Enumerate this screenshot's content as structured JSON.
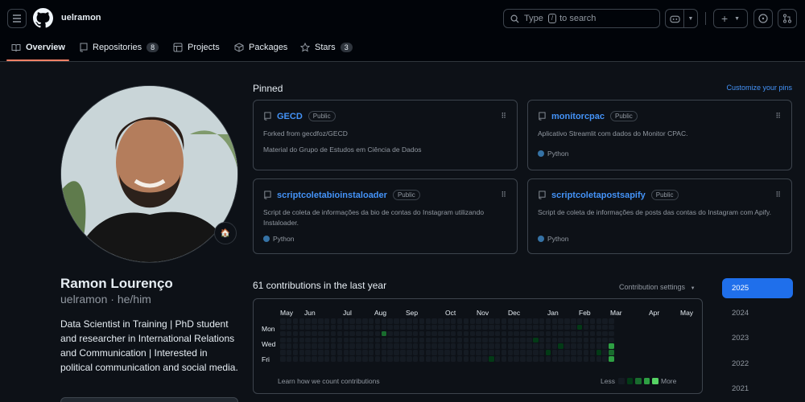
{
  "header": {
    "username": "uelramon",
    "search_placeholder": "Type",
    "search_key": "/",
    "search_suffix": "to search"
  },
  "tabs": [
    {
      "label": "Overview",
      "icon": "book-icon"
    },
    {
      "label": "Repositories",
      "count": "8",
      "icon": "repo-icon"
    },
    {
      "label": "Projects",
      "icon": "table-icon"
    },
    {
      "label": "Packages",
      "icon": "package-icon"
    },
    {
      "label": "Stars",
      "count": "3",
      "icon": "star-icon"
    }
  ],
  "profile": {
    "name": "Ramon Lourenço",
    "login": "uelramon",
    "pronouns": "he/him",
    "status_emoji": "🏠",
    "bio": "Data Scientist in Training | PhD student and researcher in International Relations and Communication | Interested in political communication and social media."
  },
  "pinned": {
    "title": "Pinned",
    "customize": "Customize your pins",
    "repos": [
      {
        "name": "GECD",
        "visibility": "Public",
        "forked_from": "Forked from gecdfoz/GECD",
        "description": "Material do Grupo de Estudos em Ciência de Dados",
        "language": ""
      },
      {
        "name": "monitorcpac",
        "visibility": "Public",
        "forked_from": "",
        "description": "Aplicativo Streamlit com dados do Monitor CPAC.",
        "language": "Python"
      },
      {
        "name": "scriptcoletabioinstaloader",
        "visibility": "Public",
        "forked_from": "",
        "description": "Script de coleta de informações da bio de contas do Instagram utilizando Instaloader.",
        "language": "Python"
      },
      {
        "name": "scriptcoletapostsapify",
        "visibility": "Public",
        "forked_from": "",
        "description": "Script de coleta de informações de posts das contas do Instagram com Apify.",
        "language": "Python"
      }
    ]
  },
  "contributions": {
    "title": "61 contributions in the last year",
    "settings": "Contribution settings",
    "months": [
      "May",
      "Jun",
      "Jul",
      "Aug",
      "Sep",
      "Oct",
      "Nov",
      "Dec",
      "Jan",
      "Feb",
      "Mar",
      "Apr",
      "May"
    ],
    "days": [
      "Mon",
      "Wed",
      "Fri"
    ],
    "learn": "Learn how we count contributions",
    "less": "Less",
    "more": "More",
    "active_cells": [
      {
        "week": 16,
        "day": 2,
        "level": 2
      },
      {
        "week": 33,
        "day": 6,
        "level": 1
      },
      {
        "week": 40,
        "day": 3,
        "level": 1
      },
      {
        "week": 42,
        "day": 5,
        "level": 1
      },
      {
        "week": 44,
        "day": 4,
        "level": 1
      },
      {
        "week": 47,
        "day": 1,
        "level": 1
      },
      {
        "week": 50,
        "day": 5,
        "level": 1
      },
      {
        "week": 52,
        "day": 4,
        "level": 3
      },
      {
        "week": 52,
        "day": 5,
        "level": 2
      },
      {
        "week": 52,
        "day": 6,
        "level": 3
      }
    ]
  },
  "years": [
    "2025",
    "2024",
    "2023",
    "2022",
    "2021"
  ],
  "colors": {
    "accent": "#1f6feb",
    "link": "#4493f8",
    "python": "#3572A5",
    "levels": [
      "#151b23",
      "#033a16",
      "#196c2e",
      "#2ea043",
      "#56d364"
    ]
  }
}
